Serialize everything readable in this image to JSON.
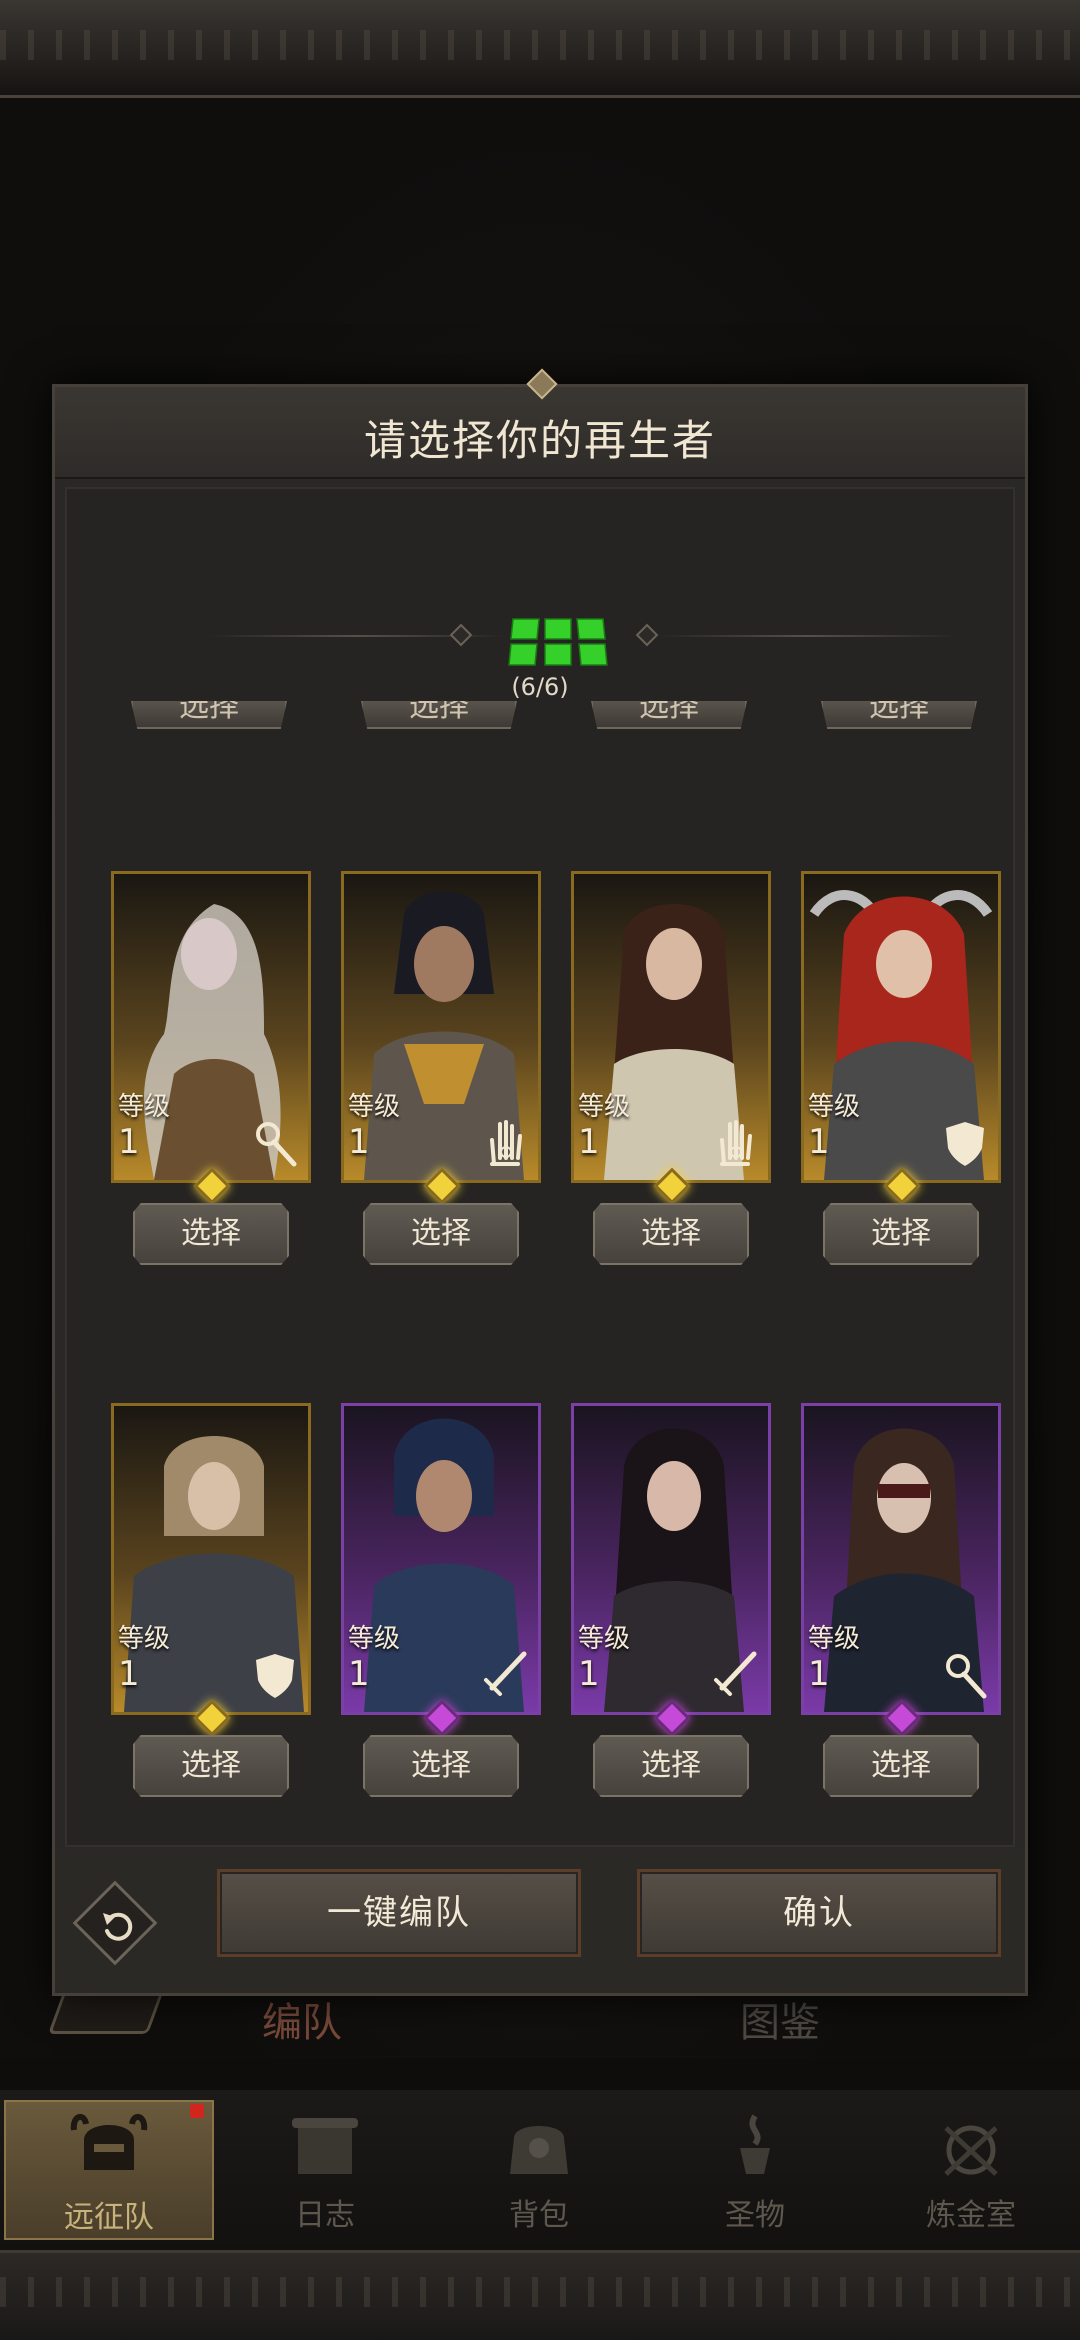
{
  "modal": {
    "title": "请选择你的再生者",
    "team_count": "(6/6)",
    "ghost_button_label": "选择",
    "select_label": "选择",
    "auto_team_label": "一键编队",
    "confirm_label": "确认"
  },
  "heroes": [
    {
      "level_label": "等级",
      "level": "1",
      "rarity": "gold",
      "class_icon": "staff-icon"
    },
    {
      "level_label": "等级",
      "level": "1",
      "rarity": "gold",
      "class_icon": "hand-icon"
    },
    {
      "level_label": "等级",
      "level": "1",
      "rarity": "gold",
      "class_icon": "hand-icon"
    },
    {
      "level_label": "等级",
      "level": "1",
      "rarity": "gold",
      "class_icon": "shield-icon"
    },
    {
      "level_label": "等级",
      "level": "1",
      "rarity": "gold",
      "class_icon": "shield-icon"
    },
    {
      "level_label": "等级",
      "level": "1",
      "rarity": "purple",
      "class_icon": "sword-icon"
    },
    {
      "level_label": "等级",
      "level": "1",
      "rarity": "purple",
      "class_icon": "sword-icon"
    },
    {
      "level_label": "等级",
      "level": "1",
      "rarity": "purple",
      "class_icon": "staff-icon"
    }
  ],
  "background_tabs": {
    "left": "编队",
    "right": "图鉴"
  },
  "nav": [
    {
      "label": "远征队",
      "icon": "helmet-icon",
      "active": true
    },
    {
      "label": "日志",
      "icon": "scroll-icon",
      "active": false
    },
    {
      "label": "背包",
      "icon": "bag-icon",
      "active": false
    },
    {
      "label": "圣物",
      "icon": "relic-icon",
      "active": false
    },
    {
      "label": "炼金室",
      "icon": "alchemy-icon",
      "active": false
    }
  ],
  "colors": {
    "team_slot": "#35d12a",
    "gold_rarity": "#b88a2a",
    "purple_rarity": "#7a3aa8",
    "badge": "#d1261d"
  }
}
